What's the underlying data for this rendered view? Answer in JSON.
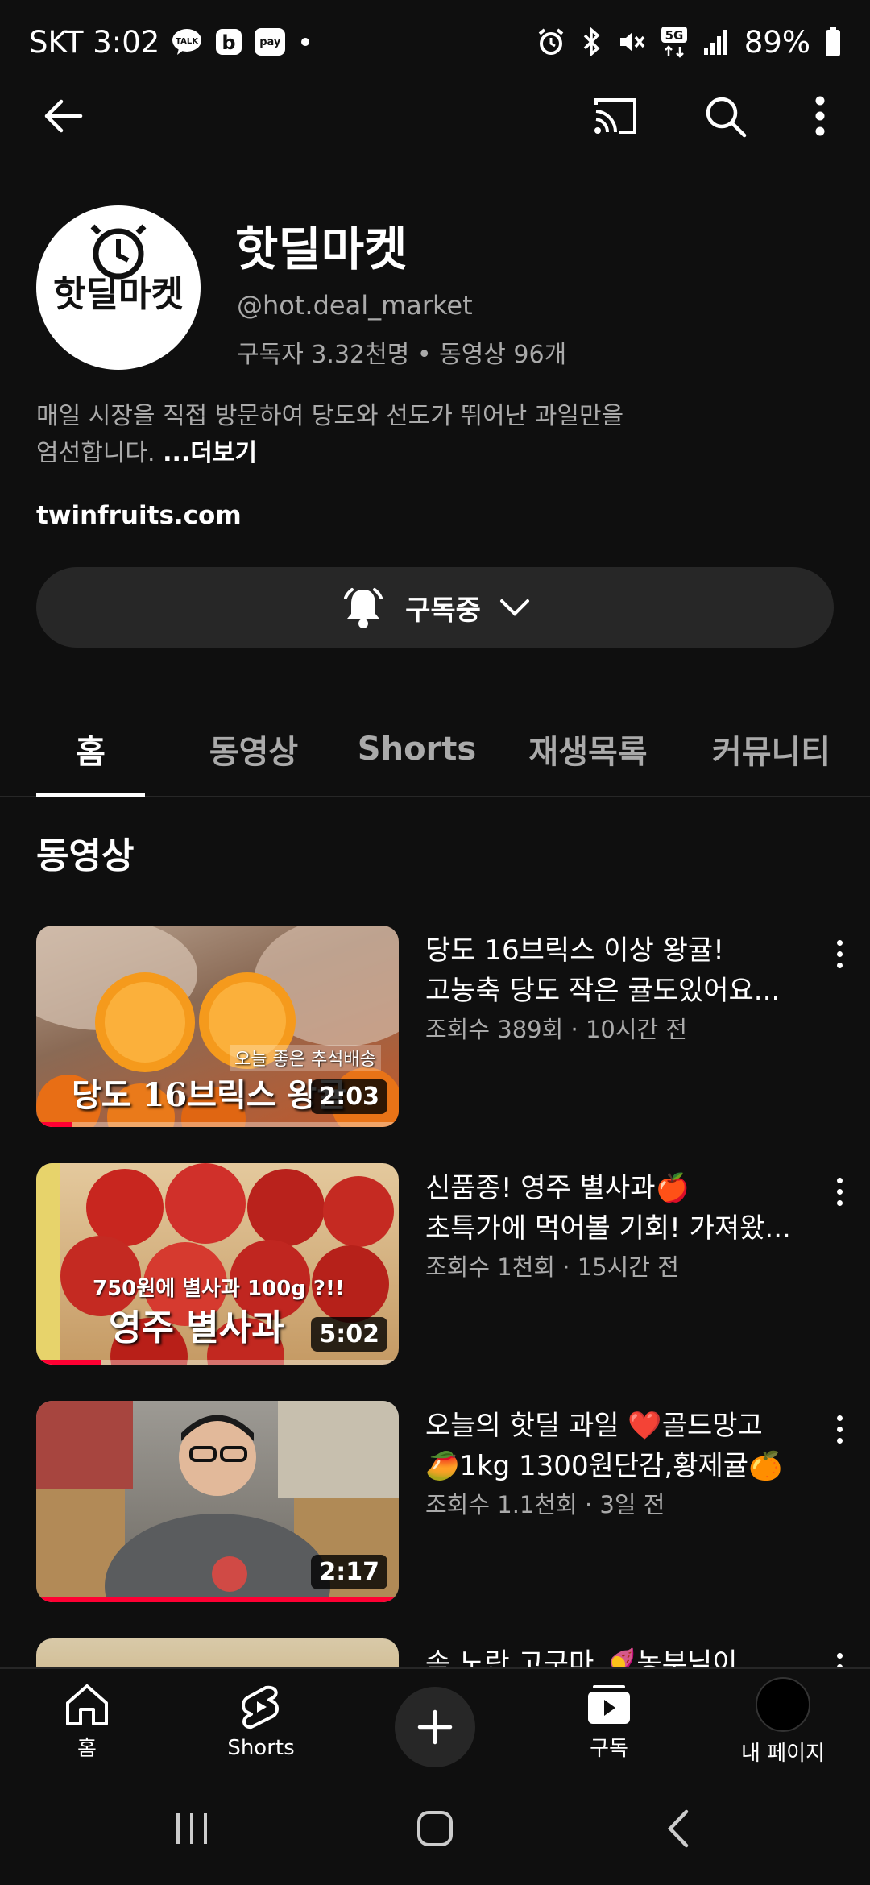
{
  "status_bar": {
    "carrier_time": "SKT 3:02",
    "talk_badge": "TALK",
    "pay_badge": "pay",
    "battery": "89%",
    "network": "5G"
  },
  "channel": {
    "name": "핫딜마켓",
    "avatar_text": "핫딜마켓",
    "handle": "@hot.deal_market",
    "stats": "구독자 3.32천명 • 동영상 96개",
    "description_line1": "매일 시장을 직접 방문하여 당도와 선도가 뛰어난 과일만을",
    "description_line2": "엄선합니다.",
    "more_label": "...더보기",
    "link": "twinfruits.com"
  },
  "subscribe_button": {
    "label": "구독중"
  },
  "tabs": [
    {
      "label": "홈",
      "active": true
    },
    {
      "label": "동영상"
    },
    {
      "label": "Shorts"
    },
    {
      "label": "재생목록"
    },
    {
      "label": "커뮤니티"
    }
  ],
  "section": {
    "title": "동영상"
  },
  "videos": [
    {
      "title_line1": "당도 16브릭스 이상 왕귤!",
      "title_line2": "고농축 당도 작은 귤도있어요...",
      "meta": "조회수 389회 · 10시간 전",
      "duration": "2:03",
      "thumb_text": "당도 16브릭스 왕귤",
      "thumb_caption": "오늘 좋은 추석배송",
      "progress": 0.1
    },
    {
      "title_line1": "신품종! 영주 별사과🍎",
      "title_line2": "초특가에 먹어볼 기회! 가져왔...",
      "meta": "조회수 1천회 · 15시간 전",
      "duration": "5:02",
      "thumb_text": "영주 별사과",
      "thumb_caption": "750원에 별사과 100g ?!!",
      "progress": 0.18
    },
    {
      "title_line1": "오늘의 핫딜 과일 ❤️골드망고",
      "title_line2": "🥭1kg 1300원단감,황제귤🍊",
      "meta": "조회수 1.1천회 · 3일 전",
      "duration": "2:17",
      "thumb_text": "",
      "thumb_caption": "",
      "progress": 1.0
    },
    {
      "title_line1": "속 노란 고구마 🍠농부님이",
      "title_line2": "",
      "meta": "",
      "duration": "",
      "thumb_text": "",
      "thumb_caption": "",
      "progress": 0
    }
  ],
  "bottom_nav": {
    "home": "홈",
    "shorts": "Shorts",
    "subscriptions": "구독",
    "me": "내 페이지"
  },
  "colors": {
    "background": "#0f0f0f",
    "surface": "#272727",
    "progress": "#ff0033",
    "secondary_text": "#aaaaaa"
  }
}
